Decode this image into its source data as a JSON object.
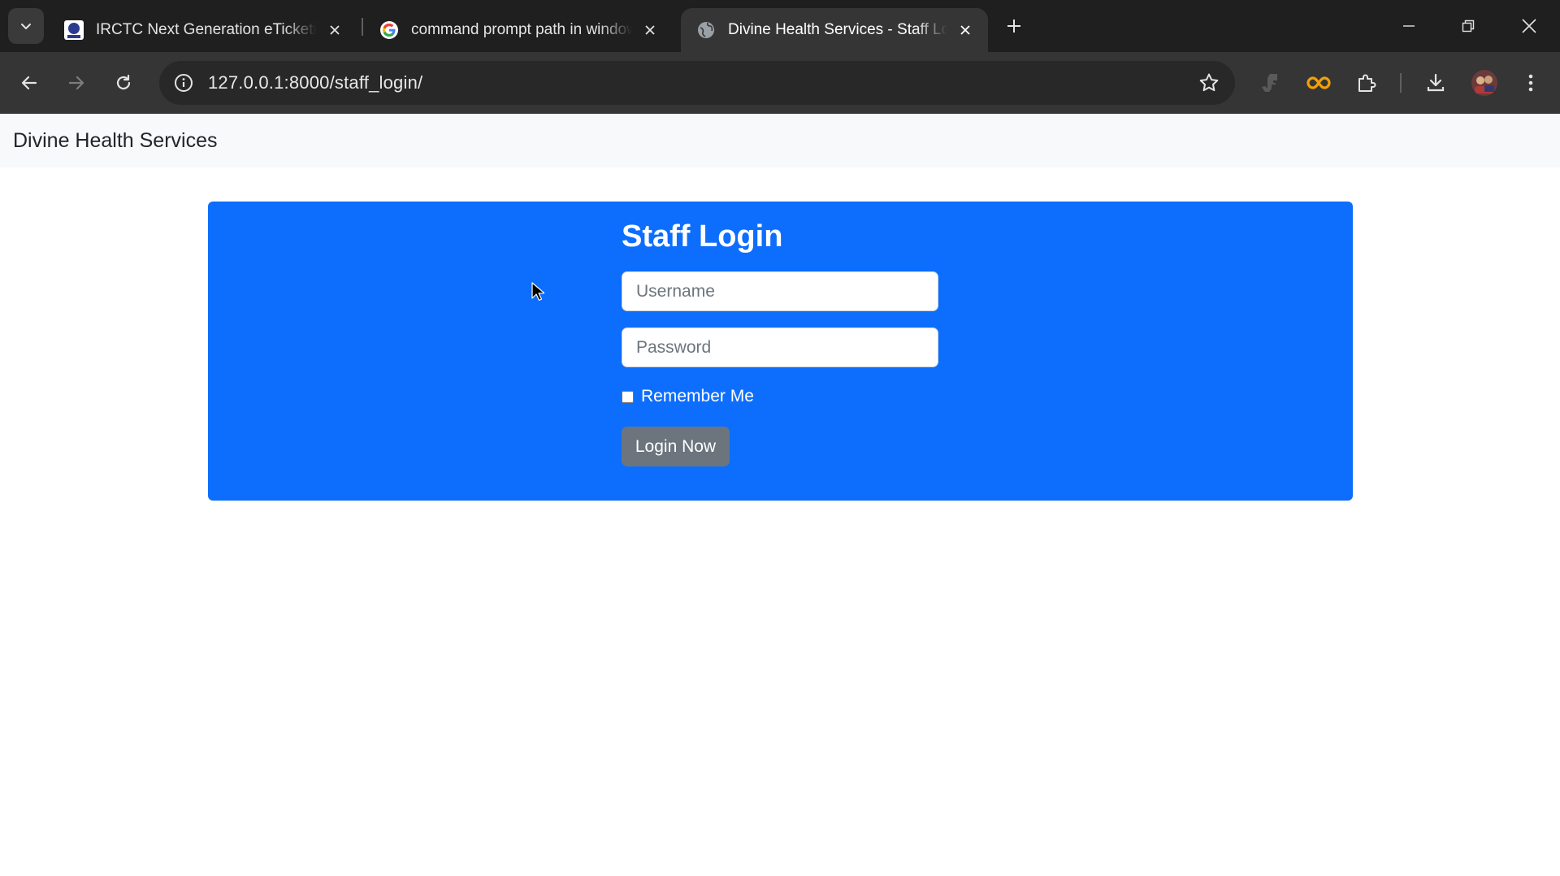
{
  "browser": {
    "tabs": [
      {
        "title": "IRCTC Next Generation eTicketing",
        "favicon": "irctc-logo-icon",
        "active": false
      },
      {
        "title": "command prompt path in windows",
        "favicon": "google-g-icon",
        "active": false
      },
      {
        "title": "Divine Health Services - Staff Login",
        "favicon": "globe-icon",
        "active": true
      }
    ],
    "url": "127.0.0.1:8000/staff_login/"
  },
  "page": {
    "brand": "Divine Health Services",
    "login": {
      "heading": "Staff Login",
      "username_placeholder": "Username",
      "password_placeholder": "Password",
      "remember_label": "Remember Me",
      "remember_checked": false,
      "submit_label": "Login Now"
    }
  },
  "colors": {
    "panel": "#0d6efd",
    "button": "#6c757d",
    "navbar": "#f8f9fa",
    "chrome_dark": "#1f1f1f",
    "chrome_toolbar": "#353535"
  }
}
